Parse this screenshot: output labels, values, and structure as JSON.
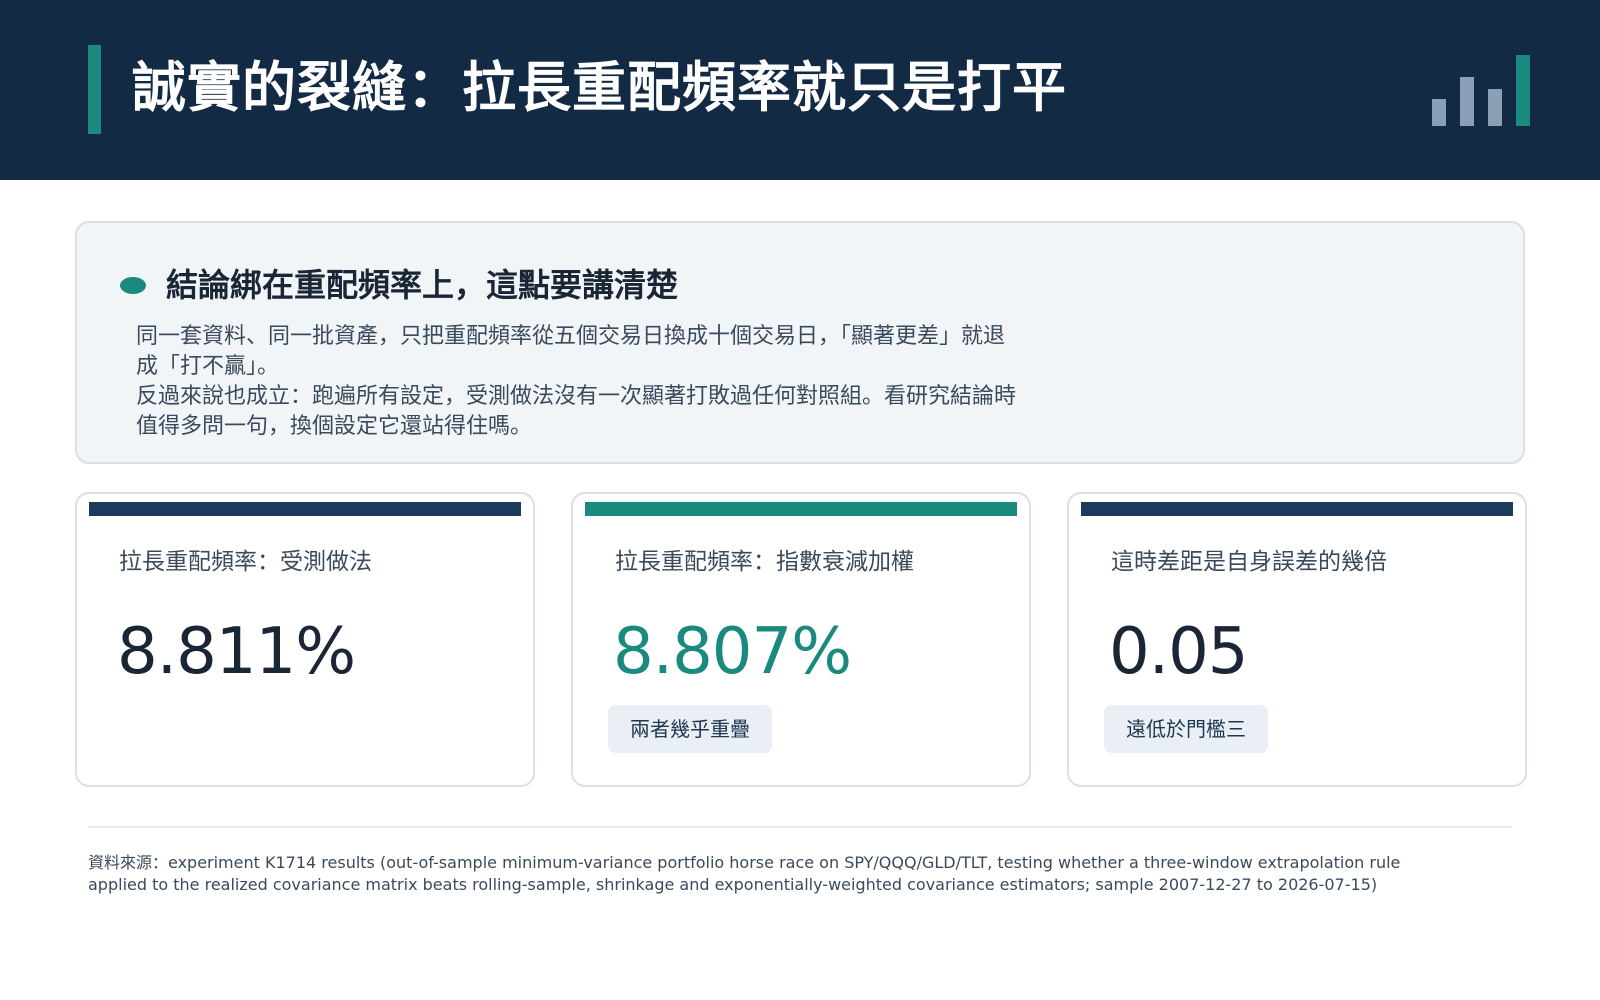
{
  "header": {
    "title": "誠實的裂縫：拉長重配頻率就只是打平"
  },
  "summary": {
    "heading": "結論綁在重配頻率上，這點要講清楚",
    "paragraphs": [
      "同一套資料、同一批資產，只把重配頻率從五個交易日換成十個交易日，「顯著更差」就退成「打不贏」。",
      "反過來說也成立：跑遍所有設定，受測做法沒有一次顯著打敗過任何對照組。看研究結論時值得多問一句，換個設定它還站得住嗎。"
    ]
  },
  "cards": [
    {
      "label": "拉長重配頻率：受測做法",
      "value": "8.811%",
      "badge": ""
    },
    {
      "label": "拉長重配頻率：指數衰減加權",
      "value": "8.807%",
      "badge": "兩者幾乎重疊"
    },
    {
      "label": "這時差距是自身誤差的幾倍",
      "value": "0.05",
      "badge": "遠低於門檻三"
    }
  ],
  "footnote": "資料來源：experiment K1714 results (out-of-sample minimum-variance portfolio horse race on SPY/QQQ/GLD/TLT, testing whether a three-window extrapolation rule applied to the realized covariance matrix beats rolling-sample, shrinkage and exponentially-weighted covariance estimators; sample 2007-12-27 to 2026-07-15)",
  "colors": {
    "navy": "#132a45",
    "teal": "#1a8a7e",
    "card_bar_1": "#1b3a5c",
    "card_bar_2": "#1a8a7e",
    "card_bar_3": "#1b3a5c",
    "value_highlight": "#1a8a7e"
  },
  "logo": {
    "icon": "bar-chart-logo"
  }
}
